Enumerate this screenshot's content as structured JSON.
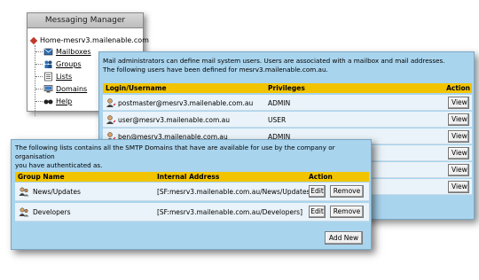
{
  "tree": {
    "title": "Messaging Manager",
    "root_label": "Home-mesrv3.mailenable.com",
    "items": [
      {
        "label": "Mailboxes",
        "icon": "mailboxes-icon"
      },
      {
        "label": "Groups",
        "icon": "groups-icon"
      },
      {
        "label": "Lists",
        "icon": "lists-icon"
      },
      {
        "label": "Domains",
        "icon": "domains-icon"
      },
      {
        "label": "Help",
        "icon": "help-icon"
      }
    ]
  },
  "users": {
    "intro_line1": "Mail administrators can define mail system users. Users are associated with a mailbox and mail addresses.",
    "intro_line2": "The following users have been defined for mesrv3.mailenable.com.au.",
    "columns": {
      "login": "Login/Username",
      "privileges": "Privileges",
      "action": "Action"
    },
    "rows": [
      {
        "login": "postmaster@mesrv3.mailenable.com.au",
        "privilege": "ADMIN",
        "action": "View"
      },
      {
        "login": "user@mesrv3.mailenable.com.au",
        "privilege": "USER",
        "action": "View"
      },
      {
        "login": "ben@mesrv3.mailenable.com.au",
        "privilege": "ADMIN",
        "action": "View"
      },
      {
        "login": "",
        "privilege": "",
        "action": "View"
      },
      {
        "login": "",
        "privilege": "",
        "action": "View"
      },
      {
        "login": "",
        "privilege": "",
        "action": "View"
      }
    ]
  },
  "lists": {
    "intro_line1": "The following lists contains all the SMTP Domains that have are available for use by the company or organisation",
    "intro_line2": "you have authenticated as.",
    "columns": {
      "group": "Group Name",
      "address": "Internal Address",
      "action": "Action"
    },
    "rows": [
      {
        "name": "News/Updates",
        "address": "[SF:mesrv3.mailenable.com.au/News/Updates]",
        "edit": "Edit",
        "remove": "Remove"
      },
      {
        "name": "Developers",
        "address": "[SF:mesrv3.mailenable.com.au/Developers]",
        "edit": "Edit",
        "remove": "Remove"
      }
    ],
    "add_new": "Add New"
  },
  "colors": {
    "panel_bg": "#a9d4ee",
    "header_bg": "#f2c400",
    "row_bg": "#eaf3f9"
  }
}
